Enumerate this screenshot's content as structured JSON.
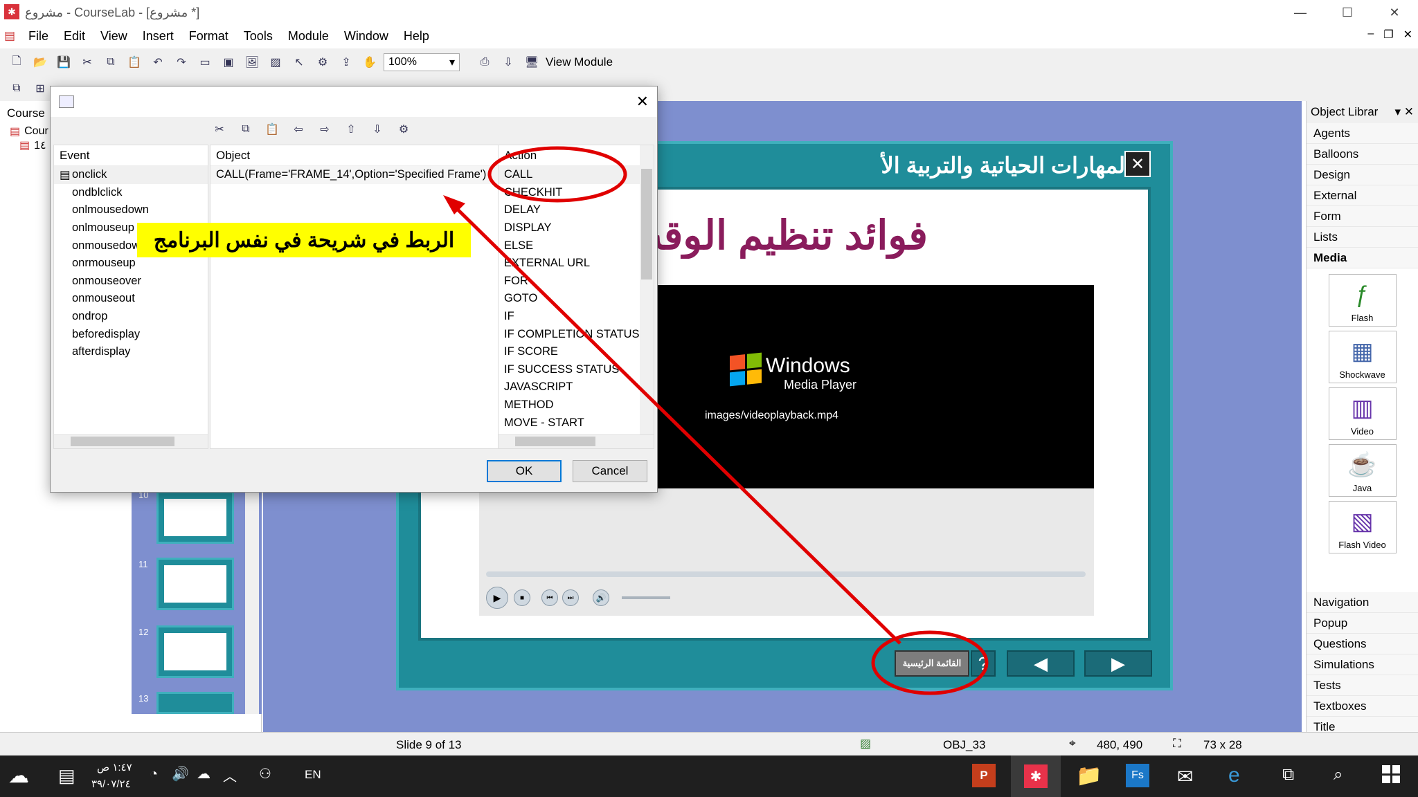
{
  "window": {
    "title": "مشروع - CourseLab - [مشروع *]",
    "minimize": "—",
    "maximize": "☐",
    "close": "✕"
  },
  "menu": [
    "File",
    "Edit",
    "View",
    "Insert",
    "Format",
    "Tools",
    "Module",
    "Window",
    "Help"
  ],
  "mdi_controls": [
    "–",
    "❐",
    "✕"
  ],
  "toolbar": {
    "zoom": "100%",
    "view_module": "View Module"
  },
  "left_panel": {
    "course_label": "Course",
    "tree": [
      "Cour",
      "1٤"
    ],
    "thumbnails": [
      "10",
      "11",
      "12",
      "13"
    ]
  },
  "dialog": {
    "ok": "OK",
    "cancel": "Cancel",
    "event_header": "Event",
    "object_header": "Object",
    "action_header": "Action",
    "events": [
      "onclick",
      "ondblclick",
      "onlmousedown",
      "onlmouseup",
      "onmousedown",
      "onrmouseup",
      "onmouseover",
      "onmouseout",
      "ondrop",
      "beforedisplay",
      "afterdisplay"
    ],
    "object_value": "CALL(Frame='FRAME_14',Option='Specified Frame')",
    "actions": [
      "CALL",
      "CHECKHIT",
      "DELAY",
      "DISPLAY",
      "ELSE",
      "EXTERNAL URL",
      "FOR",
      "GOTO",
      "IF",
      "IF COMPLETION STATUS",
      "IF SCORE",
      "IF SUCCESS STATUS",
      "JAVASCRIPT",
      "METHOD",
      "MOVE - START"
    ]
  },
  "annotation": "الربط في شريحة في نفس البرنامج",
  "slide": {
    "title": "المهارات الحياتية والتربية الأ",
    "heading": "فوائد تنظيم الوقت",
    "close": "✕",
    "video_brand": "Windows",
    "video_brand_sub": "Media Player",
    "video_path": "images/videoplayback.mp4",
    "main_menu_button": "القائمة الرئيسية",
    "help_button": "?",
    "prev": "◀",
    "next": "▶"
  },
  "object_library": {
    "title": "Object Librar",
    "categories_top": [
      "Agents",
      "Balloons",
      "Design",
      "External",
      "Form",
      "Lists",
      "Media"
    ],
    "media_items": [
      "Flash",
      "Shockwave",
      "Video",
      "Java",
      "Flash Video"
    ],
    "categories_bottom": [
      "Navigation",
      "Popup",
      "Questions",
      "Simulations",
      "Tests",
      "Textboxes",
      "Title"
    ]
  },
  "status": {
    "slide": "Slide 9 of 13",
    "object": "OBJ_33",
    "position": "480, 490",
    "size": "73 x 28"
  },
  "taskbar": {
    "time": "١:٤٧ ص",
    "date": "٣٩/٠٧/٢٤",
    "lang": "EN"
  },
  "colors": {
    "slide_teal": "#1f8d9a",
    "canvas": "#7e8fcf",
    "annotation_red": "#e00000",
    "highlight_yellow": "#ffff00",
    "title_purple": "#8a1c5c"
  }
}
